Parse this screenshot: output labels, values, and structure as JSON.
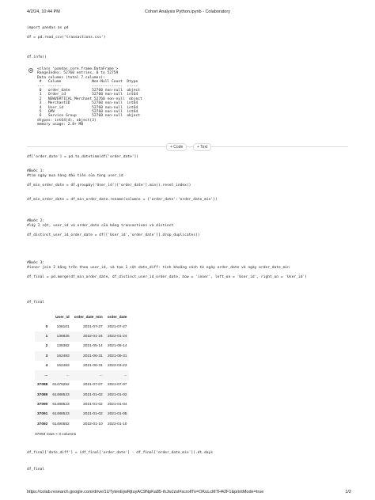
{
  "header": {
    "datetime": "4/2/24, 10:44 PM",
    "title": "Cohort Analysis Python.ipynb - Colaboratory"
  },
  "footer": {
    "url": "https://colab.research.google.com/drive/1UTytenEjwRjtuyAC9NpKa85-ihJwJzsl#scrollTo=OKuLcMTH42F1&printMode=true",
    "page": "1/2"
  },
  "cells": {
    "c1": "import pandas as pd\n\ndf = pd.read_csv('transactions.csv')",
    "c2": "df.info()",
    "info_output": "<class 'pandas.core.frame.DataFrame'>\nRangeIndex: 52760 entries, 0 to 52759\nData columns (total 7 columns):\n #   Column              Non-Null Count  Dtype\n---  ------              --------------  -----\n 0   order_date          52760 non-null  object\n 1   Order_id            52760 non-null  int64\n 2   NEWVERTICAL_Merchant 52760 non-null  object\n 3   MerchantID          52760 non-null  int64\n 4   User_id             52760 non-null  int64\n 5   GMV                 52760 non-null  int64\n 6   Service Group       52760 non-null  object\ndtypes: int64(4), object(3)\nmemory usage: 2.8+ MB",
    "c3": "df['order_date'] = pd.to_datetime(df['order_date'])",
    "c4": "#Bước 1:\n#tìm ngày mua hàng đầu tiên của từng user_id\n\ndf_min_order_date = df.groupby('User_id')['order_date'].min().reset_index()\n\n\ndf_min_order_date = df_min_order_date.rename(columns = {'order_date':'order_date_min'})",
    "c5": "#Bước 2:\n#lấy 2 cột, user_id và order_date của bảng transactions và distinct\n\ndf_distinct_user_id_order_date = df[['User_id','order_date']].drop_duplicates()",
    "c6": "#Bước 3:\n#inner join 2 bảng trên theo user_id, và tạo 1 cột date_diff: tính khoảng cách từ ngày order_date và ngày order_date_min\n\ndf_final = pd.merge(df_min_order_date, df_distinct_user_id_order_date, how = 'inner', left_on = 'User_id', right_on = 'User_id')",
    "c7": "df_final",
    "c8": "df_final['date_diff'] = (df_final['order_date'] - df_final['order_date_min']).dt.days",
    "c9": "df_final"
  },
  "toolbar": {
    "code_label": "+ Code",
    "text_label": "+ Text"
  },
  "table": {
    "columns": [
      "",
      "User_id",
      "order_date_min",
      "order_date"
    ],
    "rows": [
      [
        "0",
        "108101",
        "2021-07-27",
        "2021-07-27"
      ],
      [
        "1",
        "136825",
        "2022-01-24",
        "2022-01-24"
      ],
      [
        "2",
        "138362",
        "2021-05-14",
        "2021-05-14"
      ],
      [
        "3",
        "162483",
        "2021-06-31",
        "2021-06-31"
      ],
      [
        "4",
        "162483",
        "2021-06-31",
        "2022-03-23"
      ],
      [
        "...",
        "...",
        "...",
        "..."
      ],
      [
        "37088",
        "61479252",
        "2021-07-07",
        "2021-07-07"
      ],
      [
        "37089",
        "61488523",
        "2021-01-02",
        "2021-01-02"
      ],
      [
        "37090",
        "61488523",
        "2021-01-02",
        "2021-01-04"
      ],
      [
        "37091",
        "61488523",
        "2021-01-02",
        "2021-01-05"
      ],
      [
        "37092",
        "61490552",
        "2022-01-10",
        "2022-01-10"
      ]
    ],
    "shape_info": "37093 rows × 3 columns"
  }
}
